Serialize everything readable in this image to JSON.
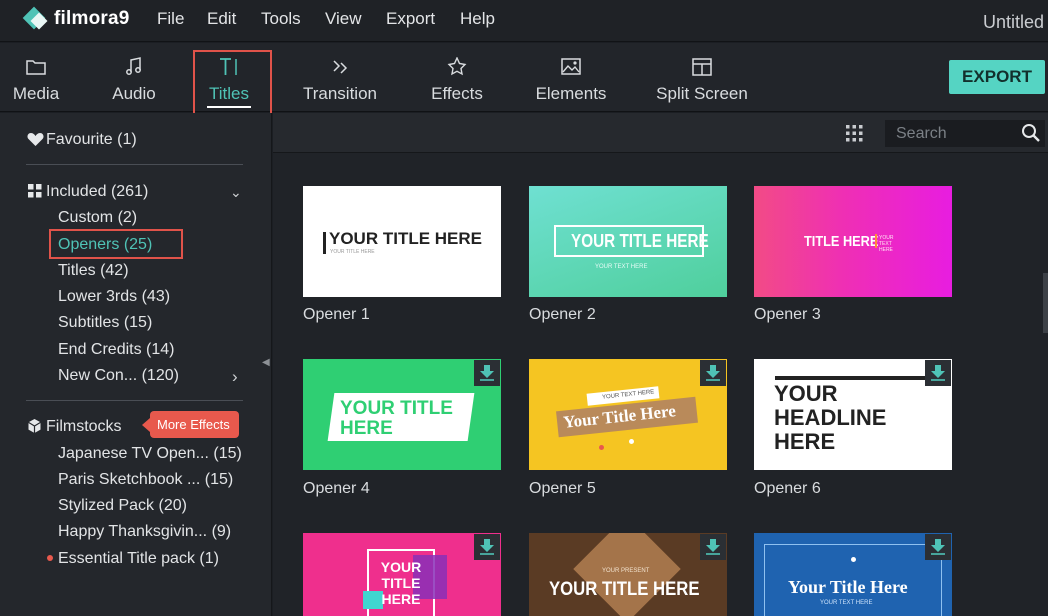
{
  "app": {
    "brand": "filmora9",
    "document_title": "Untitled",
    "accent_color": "#4fc3b6",
    "export_color": "#55d4c3",
    "highlight_color": "#e0534a"
  },
  "menu": [
    "File",
    "Edit",
    "Tools",
    "View",
    "Export",
    "Help"
  ],
  "toolbar": {
    "tabs": [
      {
        "label": "Media",
        "icon": "folder-icon"
      },
      {
        "label": "Audio",
        "icon": "music-note-icon"
      },
      {
        "label": "Titles",
        "icon": "text-cursor-icon",
        "active": true
      },
      {
        "label": "Transition",
        "icon": "transition-icon"
      },
      {
        "label": "Effects",
        "icon": "effects-icon"
      },
      {
        "label": "Elements",
        "icon": "image-icon"
      },
      {
        "label": "Split Screen",
        "icon": "split-screen-icon"
      }
    ],
    "export_label": "EXPORT"
  },
  "sidebar": {
    "favourite": "Favourite (1)",
    "included": {
      "label": "Included (261)",
      "items": [
        {
          "label": "Custom (2)"
        },
        {
          "label": "Openers (25)",
          "selected": true
        },
        {
          "label": "Titles (42)"
        },
        {
          "label": "Lower 3rds (43)"
        },
        {
          "label": "Subtitles (15)"
        },
        {
          "label": "End Credits (14)"
        },
        {
          "label": "New Con... (120)"
        }
      ]
    },
    "filmstocks": {
      "label": "Filmstocks",
      "badge": "More Effects",
      "items": [
        {
          "label": "Japanese TV Open... (15)"
        },
        {
          "label": "Paris Sketchbook ... (15)"
        },
        {
          "label": "Stylized Pack (20)"
        },
        {
          "label": "Happy Thanksgivin... (9)"
        },
        {
          "label": "Essential Title pack (1)"
        }
      ]
    }
  },
  "content": {
    "search_placeholder": "Search",
    "cards": [
      {
        "label": "Opener 1",
        "thumb_text": "YOUR TITLE HERE",
        "thumb_sub": "YOUR TITLE HERE",
        "download": false
      },
      {
        "label": "Opener 2",
        "thumb_text": "YOUR TITLE HERE",
        "thumb_sub": "YOUR TEXT HERE",
        "download": false
      },
      {
        "label": "Opener 3",
        "thumb_text": "TITLE HERE",
        "thumb_sub": "YOUR TEXT HERE",
        "download": false
      },
      {
        "label": "Opener 4",
        "thumb_text": "YOUR TITLE HERE",
        "download": true
      },
      {
        "label": "Opener 5",
        "thumb_text": "Your Title Here",
        "thumb_sub": "YOUR TEXT HERE",
        "download": true
      },
      {
        "label": "Opener 6",
        "thumb_text": "YOUR HEADLINE HERE",
        "download": true
      },
      {
        "label": "",
        "thumb_text": "YOUR TITLE HERE",
        "download": true
      },
      {
        "label": "",
        "thumb_text": "YOUR TITLE HERE",
        "thumb_sub": "YOUR PRESENT",
        "download": true
      },
      {
        "label": "",
        "thumb_text": "Your Title Here",
        "thumb_sub": "YOUR TEXT HERE",
        "download": true
      }
    ]
  }
}
